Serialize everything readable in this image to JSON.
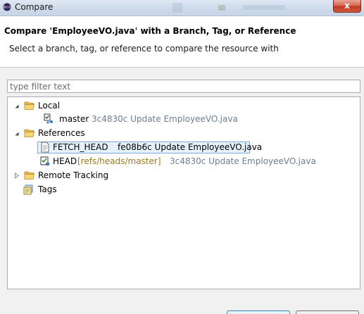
{
  "window": {
    "title": "Compare",
    "close_glyph": "x"
  },
  "header": {
    "title": "Compare 'EmployeeVO.java' with a Branch, Tag, or Reference",
    "description": "Select a branch, tag, or reference to compare the resource with"
  },
  "filter": {
    "placeholder": "type filter text",
    "value": ""
  },
  "tree": {
    "local": {
      "label": "Local",
      "children": [
        {
          "name": "master",
          "commit": "3c4830c Update EmployeeVO.java"
        }
      ]
    },
    "references": {
      "label": "References",
      "children": [
        {
          "name": "FETCH_HEAD",
          "ref": "",
          "commit": "fe08b6c Update EmployeeVO.java",
          "selected": true
        },
        {
          "name": "HEAD",
          "ref": "[refs/heads/master]",
          "commit": "3c4830c Update EmployeeVO.java",
          "selected": false
        }
      ]
    },
    "remote_tracking": {
      "label": "Remote Tracking"
    },
    "tags": {
      "label": "Tags"
    }
  },
  "icons": {
    "app": "eclipse-icon",
    "folder": "folder-open-icon",
    "branch": "branch-icon",
    "ref": "ref-file-icon",
    "head": "head-ref-icon",
    "tags": "tags-icon"
  }
}
